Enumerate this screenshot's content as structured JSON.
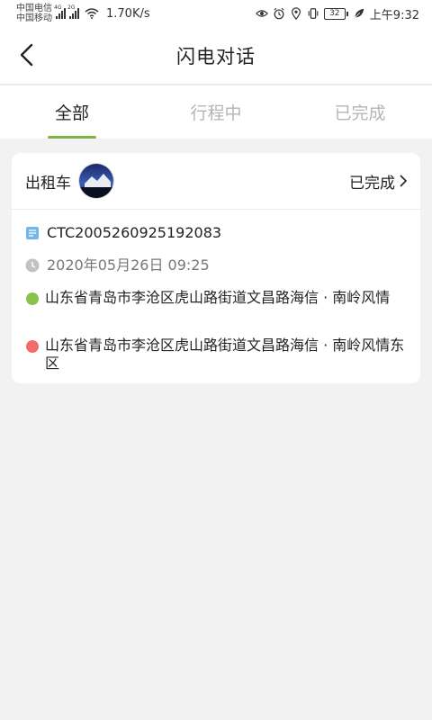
{
  "status_bar": {
    "carrier_1": "中国电信",
    "carrier_2": "中国移动",
    "signal_1_tag": "4G",
    "signal_2_tag": "2G",
    "speed": "1.70K/s",
    "battery": "32",
    "time": "上午9:32"
  },
  "nav": {
    "title": "闪电对话"
  },
  "tabs": [
    {
      "label": "全部",
      "active": true
    },
    {
      "label": "行程中",
      "active": false
    },
    {
      "label": "已完成",
      "active": false
    }
  ],
  "order": {
    "service_type": "出租车",
    "status": "已完成",
    "order_number": "CTC2005260925192083",
    "datetime": "2020年05月26日 09:25",
    "start_address": "山东省青岛市李沧区虎山路街道文昌路海信 · 南岭风情",
    "end_address": "山东省青岛市李沧区虎山路街道文昌路海信 · 南岭风情东区"
  },
  "colors": {
    "accent": "#7cb342",
    "start_dot": "#8bc34a",
    "end_dot": "#f36b6b",
    "background": "#f2f2f2"
  }
}
